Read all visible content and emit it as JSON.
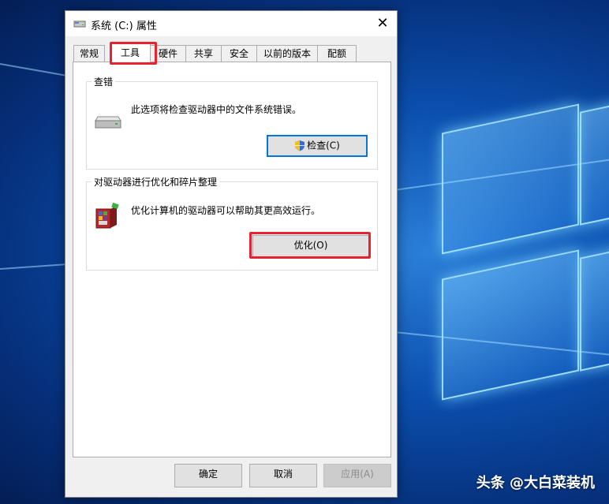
{
  "window": {
    "title": "系统 (C:) 属性",
    "close_glyph": "✕"
  },
  "tabs": [
    {
      "label": "常规",
      "active": false
    },
    {
      "label": "工具",
      "active": true
    },
    {
      "label": "硬件",
      "active": false
    },
    {
      "label": "共享",
      "active": false
    },
    {
      "label": "安全",
      "active": false
    },
    {
      "label": "以前的版本",
      "active": false
    },
    {
      "label": "配额",
      "active": false
    }
  ],
  "error_check": {
    "title": "查错",
    "description": "此选项将检查驱动器中的文件系统错误。",
    "button_label": "检查(C)",
    "icon": "drive-icon",
    "button_icon": "shield-icon"
  },
  "optimize": {
    "title": "对驱动器进行优化和碎片整理",
    "description": "优化计算机的驱动器可以帮助其更高效运行。",
    "button_label": "优化(O)",
    "icon": "defrag-icon"
  },
  "footer": {
    "ok_label": "确定",
    "cancel_label": "取消",
    "apply_label": "应用(A)"
  },
  "watermark": {
    "text": "头条 @大白菜装机"
  },
  "colors": {
    "highlight": "#e8232f",
    "focus_border": "#0078d7",
    "desktop": "#0b4fae"
  }
}
